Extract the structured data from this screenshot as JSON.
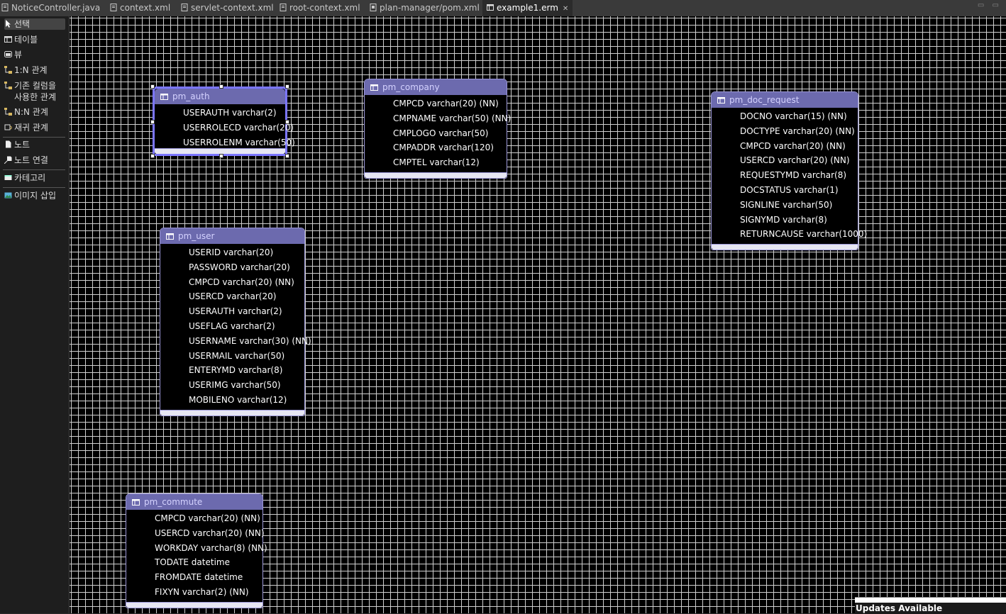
{
  "tabs": [
    {
      "label": "NoticeController.java",
      "icon": "java-file-icon"
    },
    {
      "label": "context.xml",
      "icon": "xml-file-icon"
    },
    {
      "label": "servlet-context.xml",
      "icon": "xml-file-icon"
    },
    {
      "label": "root-context.xml",
      "icon": "xml-file-icon"
    },
    {
      "label": "plan-manager/pom.xml",
      "icon": "pom-file-icon"
    },
    {
      "label": "example1.erm",
      "icon": "erm-file-icon",
      "active": true
    }
  ],
  "palette": {
    "items": [
      {
        "label": "선택",
        "icon": "arrow-cursor-icon"
      },
      {
        "label": "테이블",
        "icon": "table-icon"
      },
      {
        "label": "뷰",
        "icon": "view-icon"
      },
      {
        "label": "1:N 관계",
        "icon": "one-to-many-relation-icon"
      },
      {
        "label": "기존 컬럼을 사용한 관계",
        "icon": "existing-column-relation-icon"
      },
      {
        "label": "N:N 관계",
        "icon": "many-to-many-relation-icon"
      },
      {
        "label": "재귀 관계",
        "icon": "recursive-relation-icon"
      },
      {
        "label": "노트",
        "icon": "note-icon"
      },
      {
        "label": "노트 연결",
        "icon": "note-connection-icon"
      },
      {
        "label": "카테고리",
        "icon": "category-icon"
      },
      {
        "label": "이미지 삽입",
        "icon": "insert-image-icon"
      }
    ]
  },
  "tables": [
    {
      "name": "pm_auth",
      "columns": [
        "USERAUTH varchar(2)",
        "USERROLECD varchar(20)",
        "USERROLENM varchar(50)"
      ]
    },
    {
      "name": "pm_company",
      "columns": [
        "CMPCD varchar(20) (NN)",
        "CMPNAME varchar(50) (NN)",
        "CMPLOGO varchar(50)",
        "CMPADDR varchar(120)",
        "CMPTEL varchar(12)"
      ]
    },
    {
      "name": "pm_doc_request",
      "columns": [
        "DOCNO varchar(15) (NN)",
        "DOCTYPE varchar(20) (NN)",
        "CMPCD varchar(20) (NN)",
        "USERCD varchar(20) (NN)",
        "REQUESTYMD varchar(8)",
        "DOCSTATUS varchar(1)",
        "SIGNLINE varchar(50)",
        "SIGNYMD varchar(8)",
        "RETURNCAUSE varchar(1000)"
      ]
    },
    {
      "name": "pm_user",
      "columns": [
        "USERID varchar(20)",
        "PASSWORD varchar(20)",
        "CMPCD varchar(20) (NN)",
        "USERCD varchar(20)",
        "USERAUTH varchar(2)",
        "USEFLAG varchar(2)",
        "USERNAME varchar(30) (NN)",
        "USERMAIL varchar(50)",
        "ENTERYMD varchar(8)",
        "USERIMG varchar(50)",
        "MOBILENO varchar(12)"
      ]
    },
    {
      "name": "pm_commute",
      "columns": [
        "CMPCD varchar(20) (NN)",
        "USERCD varchar(20) (NN)",
        "WORKDAY varchar(8) (NN)",
        "TODATE datetime",
        "FROMDATE datetime",
        "FIXYN varchar(2) (NN)"
      ]
    }
  ],
  "status": {
    "updates": "Updates Available"
  },
  "colors": {
    "table_header": "#6c6aae",
    "table_border": "#9b97d8",
    "selected_border": "#7b76ff"
  }
}
